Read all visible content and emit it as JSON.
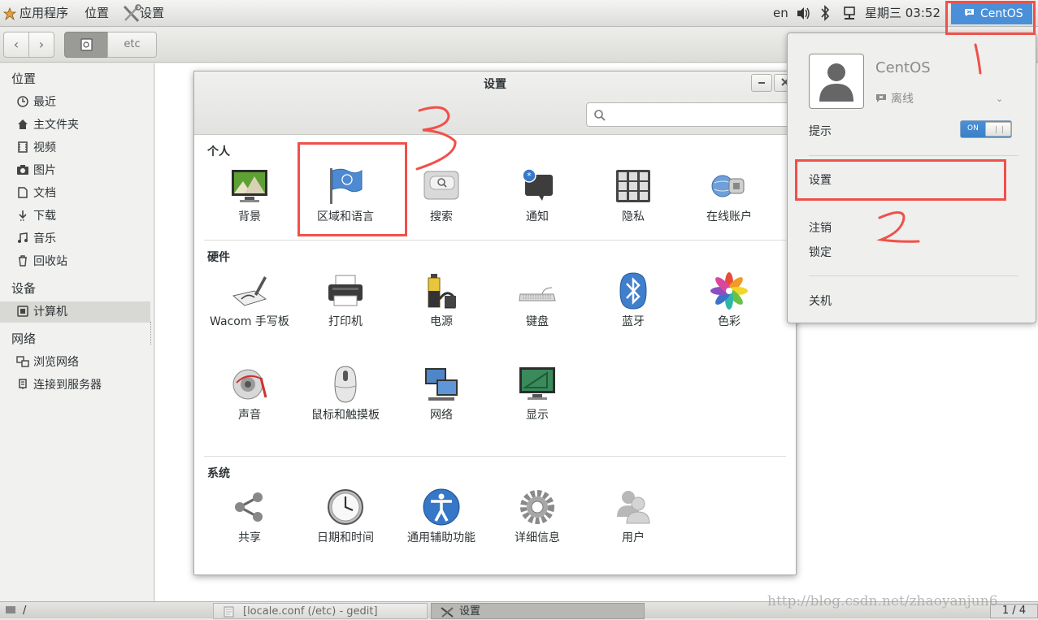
{
  "topbar": {
    "apps_label": "应用程序",
    "places_label": "位置",
    "active_app": "设置",
    "keyboard_layout": "en",
    "clock": "星期三 03:52",
    "user_button": "CentOS"
  },
  "file_manager": {
    "path_segment": "etc",
    "sidebar": {
      "places_header": "位置",
      "places": [
        {
          "label": "最近",
          "icon": "clock-icon"
        },
        {
          "label": "主文件夹",
          "icon": "home-icon"
        },
        {
          "label": "视频",
          "icon": "film-icon"
        },
        {
          "label": "图片",
          "icon": "camera-icon"
        },
        {
          "label": "文档",
          "icon": "document-icon"
        },
        {
          "label": "下载",
          "icon": "download-icon"
        },
        {
          "label": "音乐",
          "icon": "music-icon"
        },
        {
          "label": "回收站",
          "icon": "trash-icon"
        }
      ],
      "devices_header": "设备",
      "devices": [
        {
          "label": "计算机",
          "icon": "computer-icon"
        }
      ],
      "network_header": "网络",
      "network": [
        {
          "label": "浏览网络",
          "icon": "network-icon"
        },
        {
          "label": "连接到服务器",
          "icon": "server-icon"
        }
      ]
    }
  },
  "settings_window": {
    "title": "设置",
    "search_placeholder": "",
    "sections": [
      {
        "title": "个人",
        "items": [
          {
            "label": "背景",
            "icon": "background-icon"
          },
          {
            "label": "区域和语言",
            "icon": "region-flag-icon"
          },
          {
            "label": "搜索",
            "icon": "search-panel-icon"
          },
          {
            "label": "通知",
            "icon": "notifications-icon"
          },
          {
            "label": "隐私",
            "icon": "privacy-icon"
          },
          {
            "label": "在线账户",
            "icon": "online-accounts-icon"
          }
        ]
      },
      {
        "title": "硬件",
        "items": [
          {
            "label": "Wacom 手写板",
            "icon": "wacom-icon"
          },
          {
            "label": "打印机",
            "icon": "printer-icon"
          },
          {
            "label": "电源",
            "icon": "battery-icon"
          },
          {
            "label": "键盘",
            "icon": "keyboard-icon"
          },
          {
            "label": "蓝牙",
            "icon": "bluetooth-icon"
          },
          {
            "label": "色彩",
            "icon": "color-icon"
          },
          {
            "label": "声音",
            "icon": "sound-icon"
          },
          {
            "label": "鼠标和触摸板",
            "icon": "mouse-icon"
          },
          {
            "label": "网络",
            "icon": "network-panel-icon"
          },
          {
            "label": "显示",
            "icon": "display-icon"
          }
        ]
      },
      {
        "title": "系统",
        "items": [
          {
            "label": "共享",
            "icon": "share-icon"
          },
          {
            "label": "日期和时间",
            "icon": "clock-panel-icon"
          },
          {
            "label": "通用辅助功能",
            "icon": "accessibility-icon"
          },
          {
            "label": "详细信息",
            "icon": "gear-icon"
          },
          {
            "label": "用户",
            "icon": "users-icon"
          }
        ]
      }
    ]
  },
  "user_popup": {
    "username": "CentOS",
    "status": "离线",
    "notifications_label": "提示",
    "toggle_state": "ON",
    "settings_label": "设置",
    "logout_label": "注销",
    "lock_label": "锁定",
    "shutdown_label": "关机"
  },
  "taskbar": {
    "files_task": "/",
    "gedit_task": "[locale.conf (/etc) - gedit]",
    "settings_task": "设置",
    "workspace": "1 / 4"
  },
  "watermark": "http://blog.csdn.net/zhaoyanjun6",
  "colors": {
    "accent": "#4a90d9",
    "annotation": "#f0504a"
  }
}
